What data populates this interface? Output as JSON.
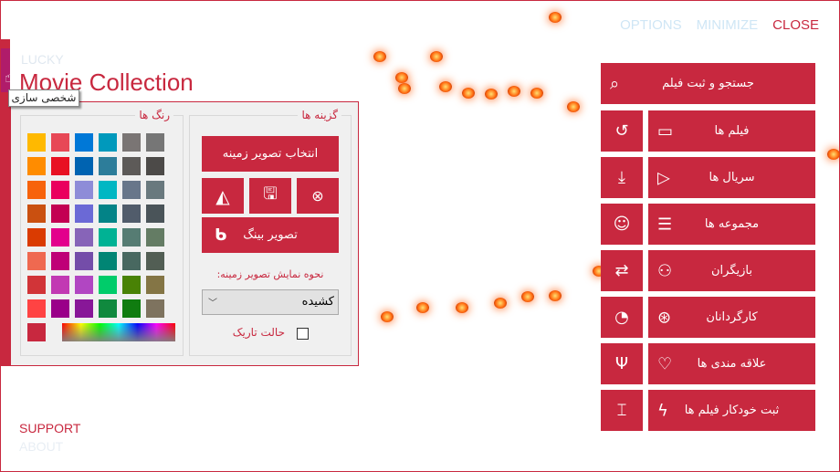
{
  "window": {
    "options": "OPTIONS",
    "minimize": "MINIMIZE",
    "close": "CLOSE"
  },
  "app": {
    "brand": "LUCKY",
    "title": "Movie Collection"
  },
  "tooltip": "شخصی سازی",
  "colors_panel": {
    "legend": "رنگ ها",
    "swatches": [
      [
        "#FFB900",
        "#E74856",
        "#0078D7",
        "#0099BC",
        "#7A7574",
        "#767676"
      ],
      [
        "#FF8C00",
        "#E81123",
        "#0063B1",
        "#2D7D9A",
        "#5D5A58",
        "#4C4A48"
      ],
      [
        "#F7630C",
        "#EA005E",
        "#8E8CD8",
        "#00B7C3",
        "#68768A",
        "#69797E"
      ],
      [
        "#CA5010",
        "#C30052",
        "#6B69D6",
        "#038387",
        "#515C6B",
        "#4A5459"
      ],
      [
        "#DA3B01",
        "#E3008C",
        "#8764B8",
        "#00B294",
        "#567C73",
        "#647C64"
      ],
      [
        "#EF6950",
        "#BF0077",
        "#744DA9",
        "#018574",
        "#486860",
        "#525E54"
      ],
      [
        "#D13438",
        "#C239B3",
        "#B146C2",
        "#00CC6A",
        "#498205",
        "#847545"
      ],
      [
        "#FF4343",
        "#9A0089",
        "#881798",
        "#10893E",
        "#107C10",
        "#7E735F"
      ]
    ],
    "current_color": "#C8283F"
  },
  "options_panel": {
    "legend": "گزینه ها",
    "choose_bg": "انتخاب تصویر زمینه",
    "bing": "تصویر بینگ",
    "display_mode_label": "نحوه نمایش تصویر زمینه:",
    "display_mode_value": "کشیده",
    "dark_mode": "حالت تاریک",
    "dark_mode_checked": false
  },
  "menu": {
    "search": "جستجو و ثبت فیلم",
    "items": [
      {
        "label": "فیلم ها",
        "icon": "film-strip-icon",
        "side_icon": "history-icon"
      },
      {
        "label": "سریال ها",
        "icon": "tv-play-icon",
        "side_icon": "download-icon"
      },
      {
        "label": "مجموعه ها",
        "icon": "playlist-icon",
        "side_icon": "theater-masks-icon"
      },
      {
        "label": "بازیگران",
        "icon": "people-icon",
        "side_icon": "import-export-icon"
      },
      {
        "label": "کارگردانان",
        "icon": "film-reel-search-icon",
        "side_icon": "pie-chart-icon"
      },
      {
        "label": "علاقه مندی ها",
        "icon": "heart-icon",
        "side_icon": "usb-icon"
      },
      {
        "label": "ثبت خودکار فیلم ها",
        "icon": "lightning-icon",
        "side_icon": "rename-icon"
      }
    ]
  },
  "footer": {
    "support": "SUPPORT",
    "about": "ABOUT"
  },
  "accent": "#C8283F"
}
